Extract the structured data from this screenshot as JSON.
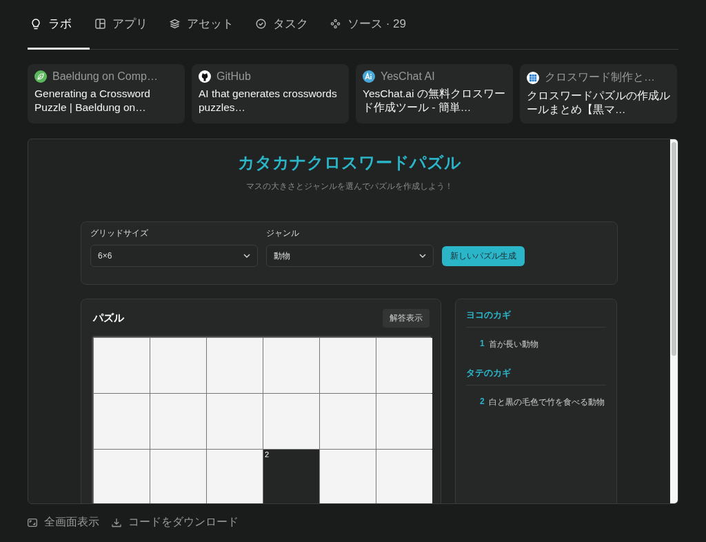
{
  "tabs": [
    {
      "label": "ラボ",
      "kind": "bulb",
      "selected": true
    },
    {
      "label": "アプリ",
      "kind": "app",
      "selected": false
    },
    {
      "label": "アセット",
      "kind": "layers",
      "selected": false
    },
    {
      "label": "タスク",
      "kind": "check",
      "selected": false
    },
    {
      "label": "ソース · 29",
      "kind": "dots",
      "selected": false
    }
  ],
  "sources": [
    {
      "site": "Baeldung on Comp…",
      "title": "Generating a Crossword Puzzle | Baeldung on…",
      "kind": "leaf"
    },
    {
      "site": "GitHub",
      "title": "AI that generates crosswords puzzles…",
      "kind": "github"
    },
    {
      "site": "YesChat AI",
      "title": "YesChat.ai の無料クロスワード作成ツール - 簡単…",
      "kind": "ai"
    },
    {
      "site": "クロスワード制作と…",
      "title": "クロスワードパズルの作成ルールまとめ【黒マ…",
      "kind": "grid"
    }
  ],
  "preview": {
    "title": "カタカナクロスワードパズル",
    "subtitle": "マスの大きさとジャンルを選んでパズルを作成しよう！",
    "settings": [
      {
        "label": "グリッドサイズ",
        "value": "6×6"
      },
      {
        "label": "ジャンル",
        "value": "動物"
      }
    ],
    "generate_button": "新しいパズル生成",
    "puzzle": {
      "heading": "パズル",
      "answer_button": "解答表示",
      "rows": [
        [
          {
            "kind": "white"
          },
          {
            "kind": "white"
          },
          {
            "kind": "white"
          },
          {
            "kind": "white"
          },
          {
            "kind": "white"
          },
          {
            "kind": "white"
          }
        ],
        [
          {
            "kind": "white"
          },
          {
            "kind": "white"
          },
          {
            "kind": "white"
          },
          {
            "kind": "white"
          },
          {
            "kind": "white"
          },
          {
            "kind": "white"
          }
        ],
        [
          {
            "kind": "white"
          },
          {
            "kind": "white"
          },
          {
            "kind": "white"
          },
          {
            "kind": "black",
            "number": "2"
          },
          {
            "kind": "white"
          },
          {
            "kind": "white"
          }
        ]
      ]
    },
    "clues": [
      {
        "heading": "ヨコのカギ",
        "items": [
          {
            "number": "1",
            "text": "首が長い動物"
          }
        ]
      },
      {
        "heading": "タテのカギ",
        "items": [
          {
            "number": "2",
            "text": "白と黒の毛色で竹を食べる動物"
          }
        ]
      }
    ]
  },
  "footer": [
    {
      "label": "全画面表示",
      "kind": "fullscreen"
    },
    {
      "label": "コードをダウンロード",
      "kind": "download"
    }
  ]
}
